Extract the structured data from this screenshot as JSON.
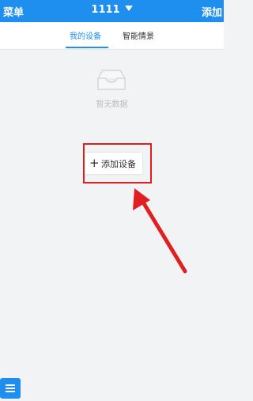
{
  "header": {
    "menu_label": "菜单",
    "title": "1111",
    "add_label": "添加"
  },
  "tabs": [
    {
      "label": "我的设备",
      "active": true
    },
    {
      "label": "智能情景",
      "active": false
    }
  ],
  "empty_state": {
    "text": "暂无数据",
    "icon": "empty-inbox-icon"
  },
  "add_device_button": {
    "label": "添加设备",
    "icon": "plus-icon"
  },
  "colors": {
    "primary": "#1e8eef",
    "annotation": "#e02020",
    "background": "#f2f3f5"
  },
  "fab": {
    "icon": "menu-lines-icon"
  }
}
